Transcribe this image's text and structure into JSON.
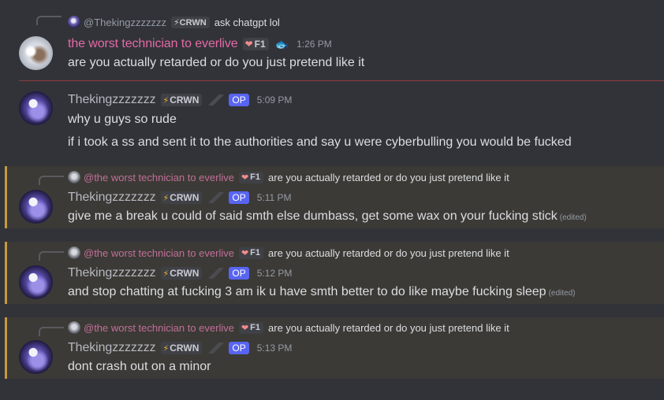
{
  "messages": [
    {
      "reply": {
        "name": "@Thekingzzzzzzz",
        "badge": "⚡CRWN",
        "text": "ask chatgpt lol"
      },
      "author": "the worst technician to everlive",
      "badge": "F1",
      "time": "1:26 PM",
      "lines": [
        "are you actually retarded or do you just pretend like it"
      ]
    },
    {
      "author": "Thekingzzzzzzz",
      "badge": "CRWN",
      "op": "OP",
      "time": "5:09 PM",
      "lines": [
        "why u guys so rude",
        "if i took a ss and sent  it to the authorities and say u were cyberbulling you would be fucked"
      ]
    },
    {
      "reply": {
        "name": "@the worst technician to everlive",
        "badge": "F1",
        "text": "are you actually retarded or do you just pretend like it"
      },
      "author": "Thekingzzzzzzz",
      "badge": "CRWN",
      "op": "OP",
      "time": "5:11 PM",
      "lines": [
        "give me a break u could of said smth else  dumbass, get some wax on your fucking stick"
      ],
      "edited": "(edited)"
    },
    {
      "reply": {
        "name": "@the worst technician to everlive",
        "badge": "F1",
        "text": "are you actually retarded or do you just pretend like it"
      },
      "author": "Thekingzzzzzzz",
      "badge": "CRWN",
      "op": "OP",
      "time": "5:12 PM",
      "lines": [
        "and stop chatting at fucking 3 am ik u have smth better to do like maybe fucking sleep"
      ],
      "edited": "(edited)"
    },
    {
      "reply": {
        "name": "@the worst technician to everlive",
        "badge": "F1",
        "text": "are you actually retarded or do you just pretend like it"
      },
      "author": "Thekingzzzzzzz",
      "badge": "CRWN",
      "op": "OP",
      "time": "5:13 PM",
      "lines": [
        "dont crash out on a minor"
      ]
    }
  ]
}
